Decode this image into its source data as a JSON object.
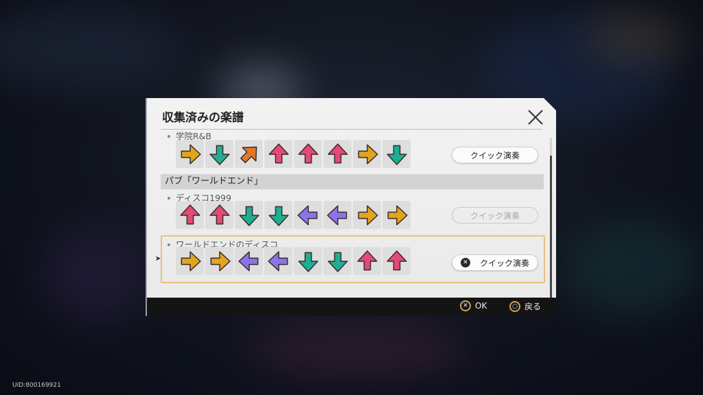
{
  "dialog": {
    "title": "収集済みの楽譜"
  },
  "songs": [
    {
      "name": "学院R&B",
      "arrows": [
        "right",
        "down",
        "upright",
        "up",
        "up",
        "up",
        "right",
        "down"
      ],
      "button": "クイック演奏",
      "state": "normal"
    },
    {
      "name": "ディスコ1999",
      "arrows": [
        "up",
        "up",
        "down",
        "down",
        "left",
        "left",
        "right",
        "right"
      ],
      "button": "クイック演奏",
      "state": "disabled"
    },
    {
      "name": "ワールドエンドのディスコ",
      "arrows": [
        "right",
        "right",
        "left",
        "left",
        "down",
        "down",
        "up",
        "up"
      ],
      "button": "クイック演奏",
      "state": "selected"
    }
  ],
  "section": {
    "header": "パブ「ワールドエンド」"
  },
  "footer": {
    "ok_label": "OK",
    "back_label": "戻る"
  },
  "uid": "UID:800169921",
  "colors": {
    "right": "#e0a51c",
    "left": "#8a74e8",
    "up": "#e24a78",
    "down": "#1fae93",
    "upright": "#e2782a",
    "selection": "#e6c37a"
  }
}
